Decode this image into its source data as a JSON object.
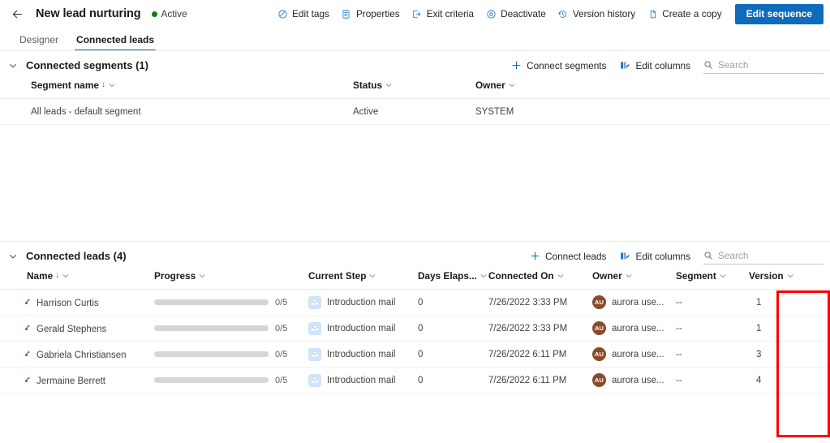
{
  "header": {
    "back_icon": "arrow-left-icon",
    "title": "New lead nurturing",
    "status_label": "Active",
    "status_color": "#107c10",
    "toolbar": [
      {
        "label": "Edit tags",
        "icon": "tag-icon"
      },
      {
        "label": "Properties",
        "icon": "properties-icon"
      },
      {
        "label": "Exit criteria",
        "icon": "exit-icon"
      },
      {
        "label": "Deactivate",
        "icon": "deactivate-icon"
      },
      {
        "label": "Version history",
        "icon": "history-icon"
      },
      {
        "label": "Create a copy",
        "icon": "copy-icon"
      }
    ],
    "primary_button": "Edit sequence",
    "primary_button_color": "#0f6cbd"
  },
  "tabs": [
    {
      "label": "Designer",
      "active": false
    },
    {
      "label": "Connected leads",
      "active": true
    }
  ],
  "segments_section": {
    "title": "Connected segments (1)",
    "collapse_icon": "chevron-down-icon",
    "actions": [
      {
        "label": "Connect segments",
        "icon": "plus-icon"
      },
      {
        "label": "Edit columns",
        "icon": "edit-columns-icon"
      }
    ],
    "search": {
      "placeholder": "Search",
      "value": "",
      "icon": "search-icon"
    },
    "columns": [
      {
        "label": "Segment name",
        "sorted": true,
        "sort_dir": "desc"
      },
      {
        "label": "Status",
        "sorted": false
      },
      {
        "label": "Owner",
        "sorted": false
      }
    ],
    "rows": [
      {
        "segment_name": "All leads - default segment",
        "status": "Active",
        "owner": "SYSTEM"
      }
    ]
  },
  "leads_section": {
    "title": "Connected leads (4)",
    "collapse_icon": "chevron-down-icon",
    "actions": [
      {
        "label": "Connect leads",
        "icon": "plus-icon"
      },
      {
        "label": "Edit columns",
        "icon": "edit-columns-icon"
      }
    ],
    "search": {
      "placeholder": "Search",
      "value": "",
      "icon": "search-icon"
    },
    "columns": [
      {
        "label": "Name",
        "sorted": true,
        "sort_dir": "desc"
      },
      {
        "label": "Progress",
        "sorted": false
      },
      {
        "label": "Current Step",
        "sorted": false
      },
      {
        "label": "Days Elaps...",
        "sorted": false
      },
      {
        "label": "Connected On",
        "sorted": false
      },
      {
        "label": "Owner",
        "sorted": false
      },
      {
        "label": "Segment",
        "sorted": false
      },
      {
        "label": "Version",
        "sorted": false
      }
    ],
    "rows": [
      {
        "name": "Harrison Curtis",
        "name_icon": "lead-icon",
        "progress_label": "0/5",
        "progress_pct": 0,
        "current_step": "Introduction mail",
        "step_icon": "mail-icon",
        "days_elapsed": "0",
        "connected_on": "7/26/2022 3:33 PM",
        "owner_initials": "AU",
        "owner": "aurora use...",
        "segment": "--",
        "version": "1"
      },
      {
        "name": "Gerald Stephens",
        "name_icon": "lead-icon",
        "progress_label": "0/5",
        "progress_pct": 0,
        "current_step": "Introduction mail",
        "step_icon": "mail-icon",
        "days_elapsed": "0",
        "connected_on": "7/26/2022 3:33 PM",
        "owner_initials": "AU",
        "owner": "aurora use...",
        "segment": "--",
        "version": "1"
      },
      {
        "name": "Gabriela Christiansen",
        "name_icon": "lead-icon",
        "progress_label": "0/5",
        "progress_pct": 0,
        "current_step": "Introduction mail",
        "step_icon": "mail-icon",
        "days_elapsed": "0",
        "connected_on": "7/26/2022 6:11 PM",
        "owner_initials": "AU",
        "owner": "aurora use...",
        "segment": "--",
        "version": "3"
      },
      {
        "name": "Jermaine Berrett",
        "name_icon": "lead-icon",
        "progress_label": "0/5",
        "progress_pct": 0,
        "current_step": "Introduction mail",
        "step_icon": "mail-icon",
        "days_elapsed": "0",
        "connected_on": "7/26/2022 6:11 PM",
        "owner_initials": "AU",
        "owner": "aurora use...",
        "segment": "--",
        "version": "4"
      }
    ]
  },
  "annotation": {
    "highlight_color": "#ff0000",
    "highlight_target": "version-column"
  }
}
